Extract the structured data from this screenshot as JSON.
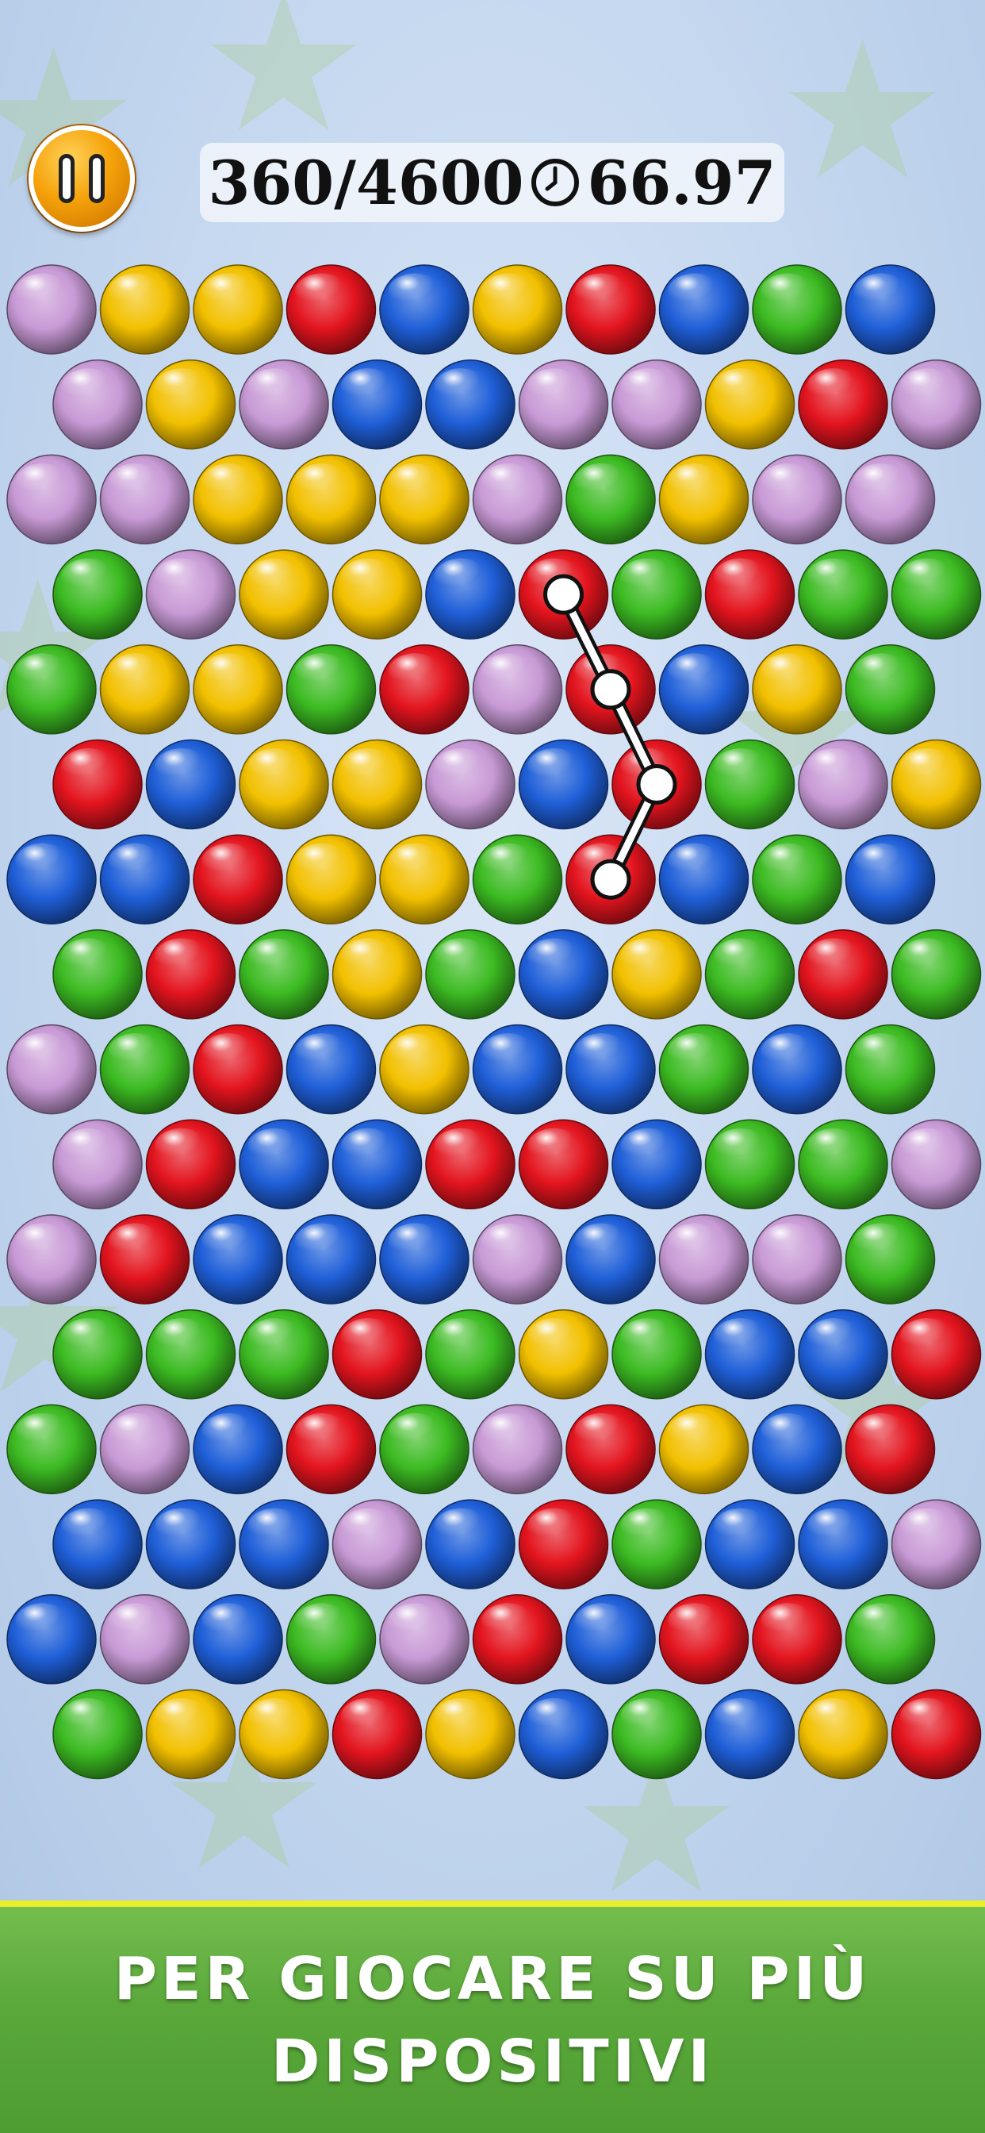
{
  "hud": {
    "score": "360",
    "target": "4600",
    "separator": "/",
    "time": "66.97",
    "icons": {
      "pause": "pause-icon",
      "clock": "clock-icon"
    }
  },
  "colors": {
    "purple": "#c89ad6",
    "yellow": "#f2c000",
    "red": "#e3141e",
    "blue": "#1f5fd8",
    "green": "#3cbb22"
  },
  "board": {
    "rows": [
      [
        "P",
        "Y",
        "Y",
        "R",
        "B",
        "Y",
        "R",
        "B",
        "G",
        "B"
      ],
      [
        "P",
        "Y",
        "P",
        "B",
        "B",
        "P",
        "P",
        "Y",
        "R",
        "P"
      ],
      [
        "P",
        "P",
        "Y",
        "Y",
        "Y",
        "P",
        "G",
        "Y",
        "P",
        "P"
      ],
      [
        "G",
        "P",
        "Y",
        "Y",
        "B",
        "R",
        "G",
        "R",
        "G",
        "G"
      ],
      [
        "G",
        "Y",
        "Y",
        "G",
        "R",
        "P",
        "R",
        "B",
        "Y",
        "G"
      ],
      [
        "R",
        "B",
        "Y",
        "Y",
        "P",
        "B",
        "R",
        "G",
        "P",
        "Y"
      ],
      [
        "B",
        "B",
        "R",
        "Y",
        "Y",
        "G",
        "R",
        "B",
        "G",
        "B"
      ],
      [
        "G",
        "R",
        "G",
        "Y",
        "G",
        "B",
        "Y",
        "G",
        "R",
        "G"
      ],
      [
        "P",
        "G",
        "R",
        "B",
        "Y",
        "B",
        "B",
        "G",
        "B",
        "G"
      ],
      [
        "P",
        "R",
        "B",
        "B",
        "R",
        "R",
        "B",
        "G",
        "G",
        "P"
      ],
      [
        "P",
        "R",
        "B",
        "B",
        "B",
        "P",
        "B",
        "P",
        "P",
        "G"
      ],
      [
        "G",
        "G",
        "G",
        "R",
        "G",
        "Y",
        "G",
        "B",
        "B",
        "R"
      ],
      [
        "G",
        "P",
        "B",
        "R",
        "G",
        "P",
        "R",
        "Y",
        "B",
        "R"
      ],
      [
        "B",
        "B",
        "B",
        "P",
        "B",
        "R",
        "G",
        "B",
        "B",
        "P"
      ],
      [
        "B",
        "P",
        "B",
        "G",
        "P",
        "R",
        "B",
        "R",
        "R",
        "G"
      ],
      [
        "G",
        "Y",
        "Y",
        "R",
        "Y",
        "B",
        "G",
        "B",
        "Y",
        "R"
      ]
    ],
    "selected_path": [
      [
        3,
        5
      ],
      [
        4,
        6
      ],
      [
        5,
        6
      ],
      [
        6,
        6
      ]
    ],
    "path_color": "#ffffff"
  },
  "banner": {
    "line1": "PER GIOCARE SU PIÙ",
    "line2": "DISPOSITIVI",
    "background": "#5aa83a",
    "border": "#e9ee2a"
  }
}
